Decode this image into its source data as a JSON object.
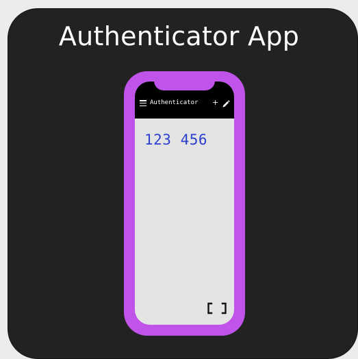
{
  "card": {
    "title": "Authenticator App"
  },
  "app": {
    "header": {
      "title": "Authenticator",
      "add_label": "+",
      "menu_icon": "hamburger-menu-icon",
      "edit_icon": "pencil-icon"
    },
    "code": "123 456",
    "scan_icon": "scan-brackets-icon"
  },
  "colors": {
    "card_background": "#232222",
    "phone_frame": "#c053ea",
    "screen_background": "#e4e4e4",
    "app_bar": "#000000",
    "code_text": "#2b3fd0"
  }
}
